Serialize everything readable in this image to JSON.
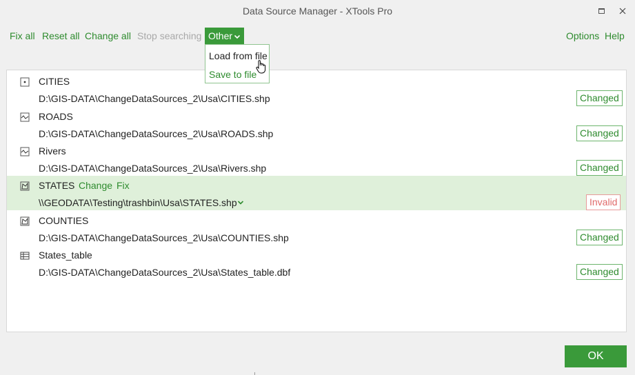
{
  "window": {
    "title": "Data Source Manager - XTools Pro"
  },
  "toolbar": {
    "fix_all": "Fix all",
    "reset_all": "Reset all",
    "change_all": "Change all",
    "stop_searching": "Stop searching",
    "other": "Other",
    "options": "Options",
    "help": "Help"
  },
  "other_menu": {
    "items": [
      {
        "label": "Load from file"
      },
      {
        "label": "Save to file"
      }
    ]
  },
  "layers": [
    {
      "name": "CITIES",
      "path": "D:\\GIS-DATA\\ChangeDataSources_2\\Usa\\CITIES.shp",
      "status": "Changed",
      "icon": "point-layer-icon"
    },
    {
      "name": "ROADS",
      "path": "D:\\GIS-DATA\\ChangeDataSources_2\\Usa\\ROADS.shp",
      "status": "Changed",
      "icon": "line-layer-icon"
    },
    {
      "name": "Rivers",
      "path": "D:\\GIS-DATA\\ChangeDataSources_2\\Usa\\Rivers.shp",
      "status": "Changed",
      "icon": "line-layer-icon"
    },
    {
      "name": "STATES",
      "path": "\\\\GEODATA\\Testing\\trashbin\\Usa\\STATES.shp",
      "status": "Invalid",
      "icon": "polygon-layer-icon",
      "change_label": "Change",
      "fix_label": "Fix"
    },
    {
      "name": "COUNTIES",
      "path": "D:\\GIS-DATA\\ChangeDataSources_2\\Usa\\COUNTIES.shp",
      "status": "Changed",
      "icon": "polygon-layer-icon"
    },
    {
      "name": "States_table",
      "path": "D:\\GIS-DATA\\ChangeDataSources_2\\Usa\\States_table.dbf",
      "status": "Changed",
      "icon": "table-icon"
    }
  ],
  "footer": {
    "ok_label": "OK"
  },
  "colors": {
    "accent": "#3a9a3a",
    "link": "#2e8b2e",
    "selected_row": "#dff0da",
    "invalid": "#e06a6a"
  }
}
